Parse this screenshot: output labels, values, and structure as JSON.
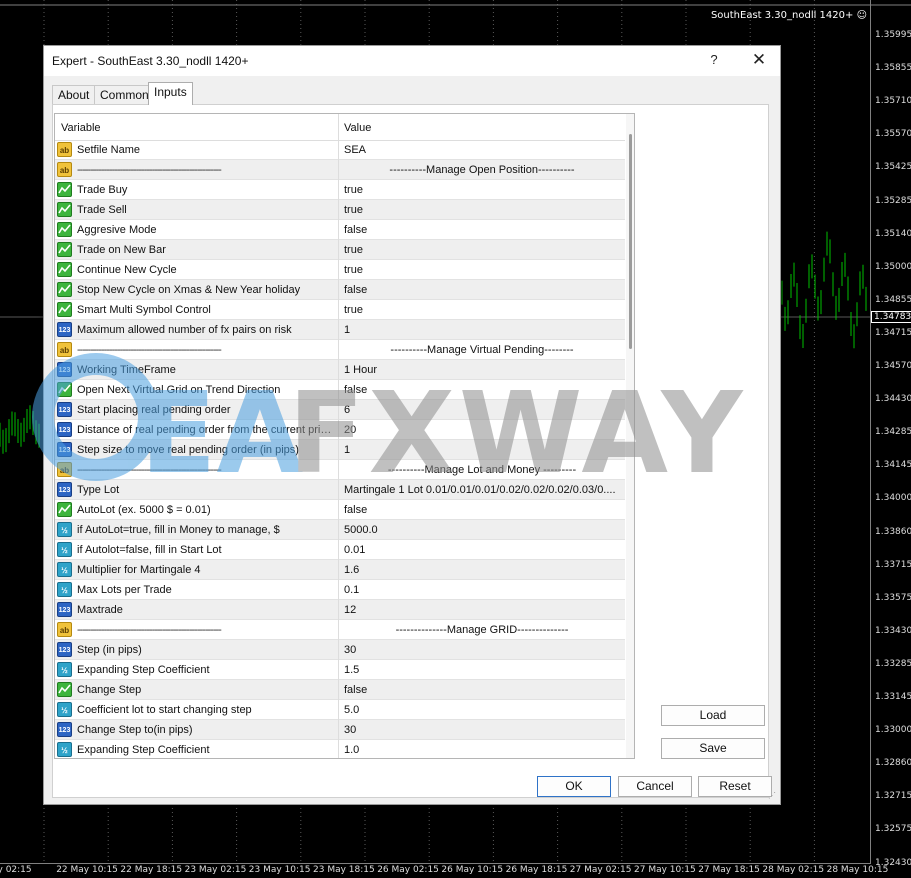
{
  "chart": {
    "title": "SouthEast 3.30_nodll 1420+ ☺",
    "prices": [
      "1.35995",
      "1.35855",
      "1.35710",
      "1.35570",
      "1.35425",
      "1.35285",
      "1.35140",
      "1.35000",
      "1.34855",
      "1.34715",
      "1.34570",
      "1.34430",
      "1.34285",
      "1.34145",
      "1.34000",
      "1.33860",
      "1.33715",
      "1.33575",
      "1.33430",
      "1.33285",
      "1.33145",
      "1.33000",
      "1.32860",
      "1.32715",
      "1.32575",
      "1.32430"
    ],
    "current_price": "1.34783",
    "times": [
      "ay 02:15",
      "22 May 10:15",
      "22 May 18:15",
      "23 May 02:15",
      "23 May 10:15",
      "23 May 18:15",
      "26 May 02:15",
      "26 May 10:15",
      "26 May 18:15",
      "27 May 02:15",
      "27 May 10:15",
      "27 May 18:15",
      "28 May 02:15",
      "28 May 10:15"
    ]
  },
  "dialog": {
    "title": "Expert - SouthEast 3.30_nodll 1420+",
    "help": "?",
    "close": "✕",
    "tabs": [
      {
        "label": "About"
      },
      {
        "label": "Common"
      },
      {
        "label": "Inputs"
      }
    ],
    "active_tab": "Inputs",
    "columns": {
      "variable": "Variable",
      "value": "Value"
    },
    "rows": [
      {
        "type": "str",
        "icon": "ab",
        "variable": "Setfile Name",
        "value": "SEA"
      },
      {
        "type": "str",
        "icon": "ab",
        "variable": "------------------------------------------------------",
        "value": "----------Manage Open Position----------",
        "header": true
      },
      {
        "type": "bool",
        "icon": "",
        "variable": "Trade Buy",
        "value": "true"
      },
      {
        "type": "bool",
        "icon": "",
        "variable": "Trade Sell",
        "value": "true"
      },
      {
        "type": "bool",
        "icon": "",
        "variable": "Aggresive Mode",
        "value": "false"
      },
      {
        "type": "bool",
        "icon": "",
        "variable": "Trade on New Bar",
        "value": "true"
      },
      {
        "type": "bool",
        "icon": "",
        "variable": "Continue New Cycle",
        "value": "true"
      },
      {
        "type": "bool",
        "icon": "",
        "variable": "Stop New Cycle on Xmas & New Year holiday",
        "value": "false"
      },
      {
        "type": "bool",
        "icon": "",
        "variable": "Smart Multi Symbol Control",
        "value": "true"
      },
      {
        "type": "int",
        "icon": "123",
        "variable": "Maximum allowed number of fx pairs on risk",
        "value": "1"
      },
      {
        "type": "str",
        "icon": "ab",
        "variable": "------------------------------------------------------",
        "value": "----------Manage Virtual Pending--------",
        "header": true
      },
      {
        "type": "int",
        "icon": "123",
        "variable": "Working TimeFrame",
        "value": "1 Hour"
      },
      {
        "type": "bool",
        "icon": "",
        "variable": "Open Next Virtual Grid on Trend Direction",
        "value": "false"
      },
      {
        "type": "int",
        "icon": "123",
        "variable": "Start placing real pending order",
        "value": "6"
      },
      {
        "type": "int",
        "icon": "123",
        "variable": "Distance of real pending order from the current price(i...",
        "value": "20"
      },
      {
        "type": "int",
        "icon": "123",
        "variable": "Step size to move real pending order (in pips)",
        "value": "1"
      },
      {
        "type": "str",
        "icon": "ab",
        "variable": "------------------------------------------------------",
        "value": "----------Manage Lot and Money ---------",
        "header": true
      },
      {
        "type": "int",
        "icon": "123",
        "variable": "Type Lot",
        "value": "Martingale 1 Lot 0.01/0.01/0.01/0.02/0.02/0.02/0.03/0...."
      },
      {
        "type": "bool",
        "icon": "",
        "variable": "AutoLot (ex. 5000 $ = 0.01)",
        "value": "false"
      },
      {
        "type": "dbl",
        "icon": "½",
        "variable": "if AutoLot=true, fill in Money to manage, $",
        "value": "5000.0"
      },
      {
        "type": "dbl",
        "icon": "½",
        "variable": "if Autolot=false, fill in Start Lot",
        "value": "0.01"
      },
      {
        "type": "dbl",
        "icon": "½",
        "variable": "Multiplier for Martingale 4",
        "value": "1.6"
      },
      {
        "type": "dbl",
        "icon": "½",
        "variable": "Max Lots per Trade",
        "value": "0.1"
      },
      {
        "type": "int",
        "icon": "123",
        "variable": "Maxtrade",
        "value": "12"
      },
      {
        "type": "str",
        "icon": "ab",
        "variable": "------------------------------------------------------",
        "value": "--------------Manage GRID--------------",
        "header": true
      },
      {
        "type": "int",
        "icon": "123",
        "variable": "Step (in pips)",
        "value": "30"
      },
      {
        "type": "dbl",
        "icon": "½",
        "variable": "Expanding Step Coefficient",
        "value": "1.5"
      },
      {
        "type": "bool",
        "icon": "",
        "variable": "Change Step",
        "value": "false"
      },
      {
        "type": "dbl",
        "icon": "½",
        "variable": "Coefficient lot to start changing step",
        "value": "5.0"
      },
      {
        "type": "int",
        "icon": "123",
        "variable": "Change Step to(in pips)",
        "value": "30"
      },
      {
        "type": "dbl",
        "icon": "½",
        "variable": "Expanding Step Coefficient",
        "value": "1.0"
      }
    ],
    "buttons": {
      "load": "Load",
      "save": "Save",
      "ok": "OK",
      "cancel": "Cancel",
      "reset": "Reset"
    }
  },
  "watermark": {
    "brand_left": "EA",
    "brand_right": "FXWAY",
    "color_blue": "#4a9fe0",
    "color_gray": "#8e8e8e"
  },
  "colors": {
    "chart_bg": "#000000",
    "candle": "#00c000",
    "dialog_bg": "#f0f0f0",
    "row_alt": "#efefef"
  }
}
